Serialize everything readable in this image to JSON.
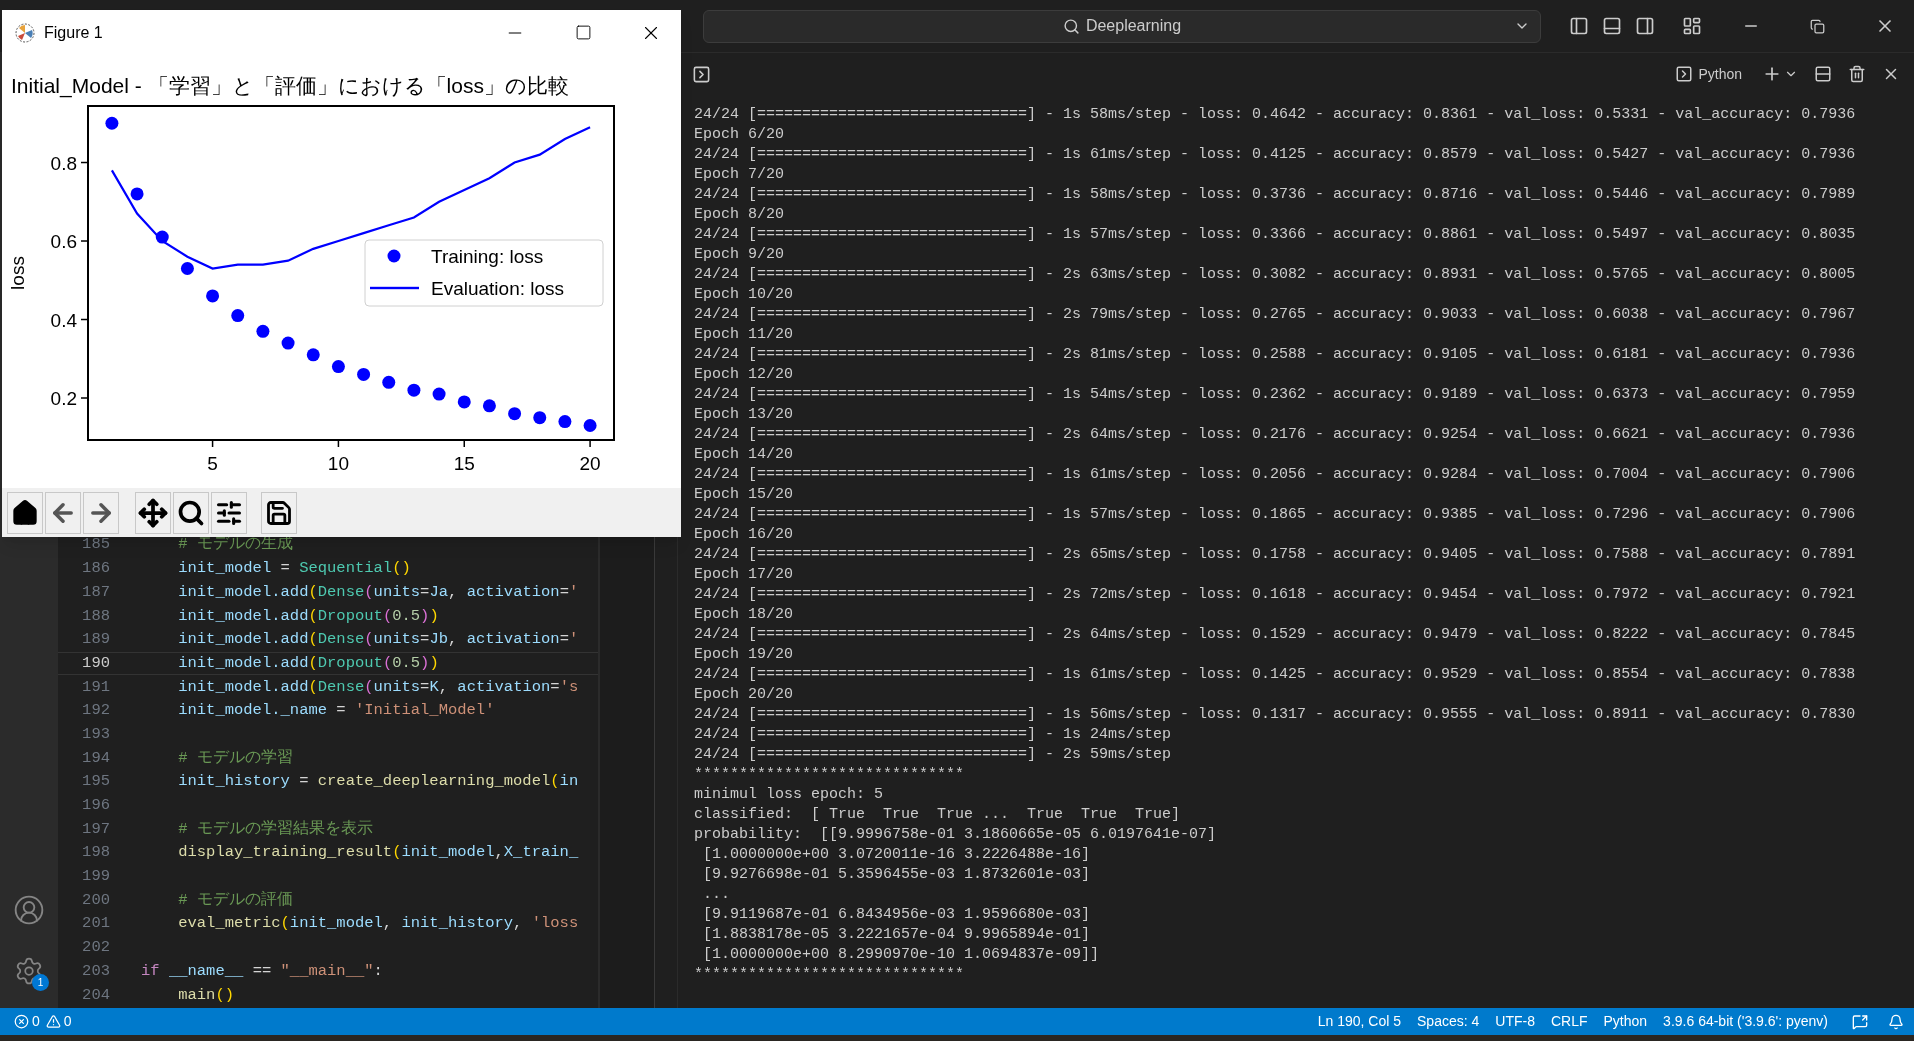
{
  "topbar": {
    "search": "Deeplearning"
  },
  "figure_window": {
    "title": "Figure 1",
    "chart_data": {
      "type": "line",
      "title": "Initial_Model - 「学習」と「評価」における「loss」の比較",
      "ylabel": "loss",
      "x": [
        1,
        2,
        3,
        4,
        5,
        6,
        7,
        8,
        9,
        10,
        11,
        12,
        13,
        14,
        15,
        16,
        17,
        18,
        19,
        20
      ],
      "series": [
        {
          "name": "Evaluation: loss",
          "color": "#0000ff",
          "values": [
            0.78,
            0.67,
            0.6,
            0.56,
            0.53,
            0.54,
            0.54,
            0.55,
            0.58,
            0.6,
            0.62,
            0.64,
            0.66,
            0.7,
            0.73,
            0.76,
            0.8,
            0.82,
            0.86,
            0.89
          ]
        },
        {
          "name": "Training: loss",
          "type": "scatter",
          "marker": "circle",
          "color": "#0000ff",
          "values": [
            0.9,
            0.72,
            0.61,
            0.53,
            0.46,
            0.41,
            0.37,
            0.34,
            0.31,
            0.28,
            0.26,
            0.24,
            0.22,
            0.21,
            0.19,
            0.18,
            0.16,
            0.15,
            0.14,
            0.13
          ]
        }
      ],
      "legend": "center right",
      "xlim": [
        0.05,
        20.95
      ],
      "ylim": [
        0.093,
        0.944
      ],
      "xticks": [
        5,
        10,
        15,
        20
      ],
      "yticks": [
        0.2,
        0.4,
        0.6,
        0.8
      ]
    }
  },
  "activity_bar": {
    "settings_badge": "1"
  },
  "editor": {
    "lines": [
      {
        "number": "185",
        "current": false,
        "tokens": [
          {
            "kind": "comment",
            "text": "    # モデルの生成"
          }
        ]
      },
      {
        "number": "186",
        "current": false,
        "tokens": [
          {
            "kind": "var",
            "text": "    init_model"
          },
          {
            "kind": "plain",
            "text": " = "
          },
          {
            "kind": "class",
            "text": "Sequential"
          },
          {
            "kind": "bracket1",
            "text": "()"
          }
        ]
      },
      {
        "number": "187",
        "current": false,
        "tokens": [
          {
            "kind": "var",
            "text": "    init_model.add"
          },
          {
            "kind": "bracket1",
            "text": "("
          },
          {
            "kind": "class",
            "text": "Dense"
          },
          {
            "kind": "bracket2",
            "text": "("
          },
          {
            "kind": "var",
            "text": "units"
          },
          {
            "kind": "plain",
            "text": "="
          },
          {
            "kind": "var",
            "text": "Ja"
          },
          {
            "kind": "plain",
            "text": ", "
          },
          {
            "kind": "var",
            "text": "activation"
          },
          {
            "kind": "plain",
            "text": "="
          },
          {
            "kind": "string",
            "text": "'"
          }
        ]
      },
      {
        "number": "188",
        "current": false,
        "tokens": [
          {
            "kind": "var",
            "text": "    init_model.add"
          },
          {
            "kind": "bracket1",
            "text": "("
          },
          {
            "kind": "class",
            "text": "Dropout"
          },
          {
            "kind": "bracket2",
            "text": "("
          },
          {
            "kind": "number",
            "text": "0.5"
          },
          {
            "kind": "bracket2",
            "text": ")"
          },
          {
            "kind": "bracket1",
            "text": ")"
          }
        ]
      },
      {
        "number": "189",
        "current": false,
        "tokens": [
          {
            "kind": "var",
            "text": "    init_model.add"
          },
          {
            "kind": "bracket1",
            "text": "("
          },
          {
            "kind": "class",
            "text": "Dense"
          },
          {
            "kind": "bracket2",
            "text": "("
          },
          {
            "kind": "var",
            "text": "units"
          },
          {
            "kind": "plain",
            "text": "="
          },
          {
            "kind": "var",
            "text": "Jb"
          },
          {
            "kind": "plain",
            "text": ", "
          },
          {
            "kind": "var",
            "text": "activation"
          },
          {
            "kind": "plain",
            "text": "="
          },
          {
            "kind": "string",
            "text": "'"
          }
        ]
      },
      {
        "number": "190",
        "current": true,
        "tokens": [
          {
            "kind": "var",
            "text": "    init_model.add"
          },
          {
            "kind": "bracket1",
            "text": "("
          },
          {
            "kind": "class",
            "text": "Dropout"
          },
          {
            "kind": "bracket2",
            "text": "("
          },
          {
            "kind": "number",
            "text": "0.5"
          },
          {
            "kind": "bracket2",
            "text": ")"
          },
          {
            "kind": "bracket1",
            "text": ")"
          }
        ]
      },
      {
        "number": "191",
        "current": false,
        "tokens": [
          {
            "kind": "var",
            "text": "    init_model.add"
          },
          {
            "kind": "bracket1",
            "text": "("
          },
          {
            "kind": "class",
            "text": "Dense"
          },
          {
            "kind": "bracket2",
            "text": "("
          },
          {
            "kind": "var",
            "text": "units"
          },
          {
            "kind": "plain",
            "text": "="
          },
          {
            "kind": "var",
            "text": "K"
          },
          {
            "kind": "plain",
            "text": ", "
          },
          {
            "kind": "var",
            "text": "activation"
          },
          {
            "kind": "plain",
            "text": "="
          },
          {
            "kind": "string",
            "text": "'s"
          }
        ]
      },
      {
        "number": "192",
        "current": false,
        "tokens": [
          {
            "kind": "var",
            "text": "    init_model._name"
          },
          {
            "kind": "plain",
            "text": " = "
          },
          {
            "kind": "string",
            "text": "'Initial_Model'"
          }
        ]
      },
      {
        "number": "193",
        "current": false
      },
      {
        "number": "194",
        "current": false,
        "tokens": [
          {
            "kind": "comment",
            "text": "    # モデルの学習"
          }
        ]
      },
      {
        "number": "195",
        "current": false,
        "tokens": [
          {
            "kind": "var",
            "text": "    init_history"
          },
          {
            "kind": "plain",
            "text": " = "
          },
          {
            "kind": "func",
            "text": "create_deeplearning_model"
          },
          {
            "kind": "bracket1",
            "text": "("
          },
          {
            "kind": "var",
            "text": "in"
          }
        ]
      },
      {
        "number": "196",
        "current": false
      },
      {
        "number": "197",
        "current": false,
        "tokens": [
          {
            "kind": "comment",
            "text": "    # モデルの学習結果を表示"
          }
        ]
      },
      {
        "number": "198",
        "current": false,
        "tokens": [
          {
            "kind": "func",
            "text": "    display_training_result"
          },
          {
            "kind": "bracket1",
            "text": "("
          },
          {
            "kind": "var",
            "text": "init_model"
          },
          {
            "kind": "plain",
            "text": ","
          },
          {
            "kind": "var",
            "text": "X_train_"
          }
        ]
      },
      {
        "number": "199",
        "current": false
      },
      {
        "number": "200",
        "current": false,
        "tokens": [
          {
            "kind": "comment",
            "text": "    # モデルの評価"
          }
        ]
      },
      {
        "number": "201",
        "current": false,
        "tokens": [
          {
            "kind": "func",
            "text": "    eval_metric"
          },
          {
            "kind": "bracket1",
            "text": "("
          },
          {
            "kind": "var",
            "text": "init_model"
          },
          {
            "kind": "plain",
            "text": ", "
          },
          {
            "kind": "var",
            "text": "init_history"
          },
          {
            "kind": "plain",
            "text": ", "
          },
          {
            "kind": "string",
            "text": "'loss"
          }
        ]
      },
      {
        "number": "202",
        "current": false
      },
      {
        "number": "203",
        "current": false,
        "tokens": [
          {
            "kind": "keyword",
            "text": "if"
          },
          {
            "kind": "var",
            "text": " __name__"
          },
          {
            "kind": "plain",
            "text": " == "
          },
          {
            "kind": "string",
            "text": "\"__main__\""
          },
          {
            "kind": "plain",
            "text": ":"
          }
        ]
      },
      {
        "number": "204",
        "current": false,
        "tokens": [
          {
            "kind": "func",
            "text": "    main"
          },
          {
            "kind": "bracket1",
            "text": "()"
          }
        ]
      }
    ]
  },
  "panel": {
    "terminal_profile": "Python",
    "lines": [
      "24/24 [==============================] - 1s 58ms/step - loss: 0.4642 - accuracy: 0.8361 - val_loss: 0.5331 - val_accuracy: 0.7936",
      "Epoch 6/20",
      "24/24 [==============================] - 1s 61ms/step - loss: 0.4125 - accuracy: 0.8579 - val_loss: 0.5427 - val_accuracy: 0.7936",
      "Epoch 7/20",
      "24/24 [==============================] - 1s 58ms/step - loss: 0.3736 - accuracy: 0.8716 - val_loss: 0.5446 - val_accuracy: 0.7989",
      "Epoch 8/20",
      "24/24 [==============================] - 1s 57ms/step - loss: 0.3366 - accuracy: 0.8861 - val_loss: 0.5497 - val_accuracy: 0.8035",
      "Epoch 9/20",
      "24/24 [==============================] - 2s 63ms/step - loss: 0.3082 - accuracy: 0.8931 - val_loss: 0.5765 - val_accuracy: 0.8005",
      "Epoch 10/20",
      "24/24 [==============================] - 2s 79ms/step - loss: 0.2765 - accuracy: 0.9033 - val_loss: 0.6038 - val_accuracy: 0.7967",
      "Epoch 11/20",
      "24/24 [==============================] - 2s 81ms/step - loss: 0.2588 - accuracy: 0.9105 - val_loss: 0.6181 - val_accuracy: 0.7936",
      "Epoch 12/20",
      "24/24 [==============================] - 1s 54ms/step - loss: 0.2362 - accuracy: 0.9189 - val_loss: 0.6373 - val_accuracy: 0.7959",
      "Epoch 13/20",
      "24/24 [==============================] - 2s 64ms/step - loss: 0.2176 - accuracy: 0.9254 - val_loss: 0.6621 - val_accuracy: 0.7936",
      "Epoch 14/20",
      "24/24 [==============================] - 1s 61ms/step - loss: 0.2056 - accuracy: 0.9284 - val_loss: 0.7004 - val_accuracy: 0.7906",
      "Epoch 15/20",
      "24/24 [==============================] - 1s 57ms/step - loss: 0.1865 - accuracy: 0.9385 - val_loss: 0.7296 - val_accuracy: 0.7906",
      "Epoch 16/20",
      "24/24 [==============================] - 2s 65ms/step - loss: 0.1758 - accuracy: 0.9405 - val_loss: 0.7588 - val_accuracy: 0.7891",
      "Epoch 17/20",
      "24/24 [==============================] - 2s 72ms/step - loss: 0.1618 - accuracy: 0.9454 - val_loss: 0.7972 - val_accuracy: 0.7921",
      "Epoch 18/20",
      "24/24 [==============================] - 2s 64ms/step - loss: 0.1529 - accuracy: 0.9479 - val_loss: 0.8222 - val_accuracy: 0.7845",
      "Epoch 19/20",
      "24/24 [==============================] - 1s 61ms/step - loss: 0.1425 - accuracy: 0.9529 - val_loss: 0.8554 - val_accuracy: 0.7838",
      "Epoch 20/20",
      "24/24 [==============================] - 1s 56ms/step - loss: 0.1317 - accuracy: 0.9555 - val_loss: 0.8911 - val_accuracy: 0.7830",
      "24/24 [==============================] - 1s 24ms/step",
      "24/24 [==============================] - 2s 59ms/step",
      "******************************",
      "minimul loss epoch: 5",
      "classified:  [ True  True  True ...  True  True  True]",
      "probability:  [[9.9996758e-01 3.1860665e-05 6.0197641e-07]",
      " [1.0000000e+00 3.0720011e-16 3.2226488e-16]",
      " [9.9276698e-01 5.3596455e-03 1.8732601e-03]",
      " ...",
      " [9.9119687e-01 6.8434956e-03 1.9596680e-03]",
      " [1.8838178e-05 3.2221657e-04 9.9965894e-01]",
      " [1.0000000e+00 8.2990970e-10 1.0694837e-09]]",
      "******************************"
    ]
  },
  "status_bar": {
    "errors": "0",
    "warnings": "0",
    "items": [
      "Ln 190, Col 5",
      "Spaces: 4",
      "UTF-8",
      "CRLF",
      "Python",
      "3.9.6 64-bit ('3.9.6': pyenv)"
    ]
  }
}
